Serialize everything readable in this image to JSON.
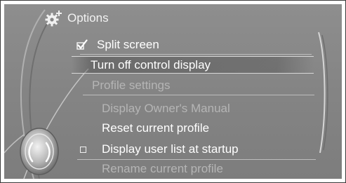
{
  "menu": {
    "title": "Options",
    "title_icon": "gear-plus-icon",
    "items": [
      {
        "label": "Split screen",
        "control": "checkbox",
        "checked": true,
        "state": "enabled"
      },
      {
        "label": "Turn off control display",
        "control": "none",
        "state": "selected"
      },
      {
        "label": "Profile settings",
        "control": "none",
        "state": "section-header"
      },
      {
        "label": "Display Owner's Manual",
        "control": "none",
        "state": "disabled"
      },
      {
        "label": "Reset current profile",
        "control": "none",
        "state": "enabled"
      },
      {
        "label": "Display user list at startup",
        "control": "checkbox",
        "checked": false,
        "state": "enabled"
      },
      {
        "label": "Rename current profile",
        "control": "none",
        "state": "disabled"
      }
    ]
  },
  "controller_icon": "idrive-controller-icon",
  "colors": {
    "background": "#858585",
    "text_enabled": "#ffffff",
    "text_disabled": "#b5b5b5",
    "highlight_line": "#d8d8d8"
  }
}
